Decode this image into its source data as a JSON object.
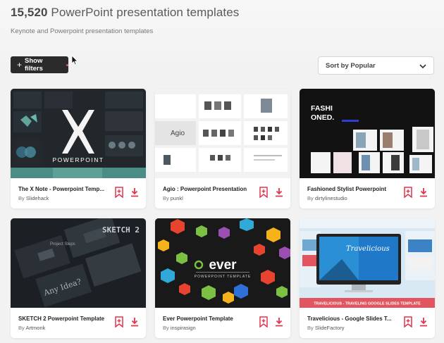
{
  "header": {
    "count": "15,520",
    "title_rest": " PowerPoint presentation templates",
    "subtitle": "Keynote and Powerpoint presentation templates"
  },
  "toolbar": {
    "filters_label": "Show filters",
    "sort_label": "Sort by Popular"
  },
  "colors": {
    "accent": "#e0354f",
    "dark_button": "#2b2b2b"
  },
  "cards": [
    {
      "title": "The X Note - Powerpoint Temp...",
      "by": "By",
      "author": "Slidehack",
      "thumb_text": "POWERPOINT",
      "thumb_big": "X"
    },
    {
      "title": "Agio : Powerpoint Presentation",
      "by": "By",
      "author": "punkl",
      "thumb_text": "Agio"
    },
    {
      "title": "Fashioned Stylist Powerpoint",
      "by": "By",
      "author": "dirtylinestudio",
      "thumb_text": "FASHI ONED."
    },
    {
      "title": "SKETCH 2 Powerpoint Template",
      "by": "By",
      "author": "Artmonk",
      "thumb_text": "SKETCH 2"
    },
    {
      "title": "Ever Powerpoint Template",
      "by": "By",
      "author": "inspirasign",
      "thumb_text": "ever",
      "thumb_sub": "POWERPOINT TEMPLATE"
    },
    {
      "title": "Travelicious - Google Slides T...",
      "by": "By",
      "author": "SlideFactory",
      "thumb_text": "Travelicious",
      "thumb_banner": "TRAVELICIOUS - TRAVELING GOOGLE SLIDES TEMPLATE"
    }
  ],
  "icons": [
    "cursor-icon",
    "plus-icon",
    "chevron-down-icon",
    "bookmark-plus-icon",
    "download-icon"
  ]
}
